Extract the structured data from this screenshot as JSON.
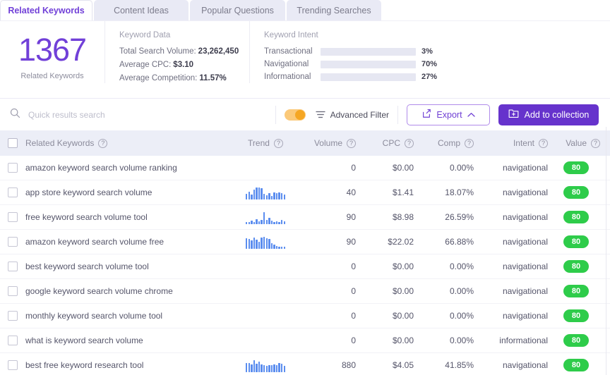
{
  "tabs": [
    {
      "label": "Related Keywords",
      "active": true
    },
    {
      "label": "Content Ideas",
      "active": false
    },
    {
      "label": "Popular Questions",
      "active": false
    },
    {
      "label": "Trending Searches",
      "active": false
    }
  ],
  "summary": {
    "count": "1367",
    "count_label": "Related Keywords",
    "keyword_data": {
      "title": "Keyword Data",
      "rows": [
        {
          "label": "Total Search Volume:",
          "value": "23,262,450"
        },
        {
          "label": "Average CPC:",
          "value": "$3.10"
        },
        {
          "label": "Average Competition:",
          "value": "11.57%"
        }
      ]
    },
    "keyword_intent": {
      "title": "Keyword Intent",
      "rows": [
        {
          "label": "Transactional",
          "pct": "3%",
          "value": 3,
          "color": "#e8312a"
        },
        {
          "label": "Navigational",
          "pct": "70%",
          "value": 70,
          "color": "#fbbc05"
        },
        {
          "label": "Informational",
          "pct": "27%",
          "value": 27,
          "color": "#27c93f"
        }
      ]
    }
  },
  "toolbar": {
    "search_placeholder": "Quick results search",
    "search_value": "",
    "toggle_on": true,
    "advanced_filter_label": "Advanced Filter",
    "export_label": "Export",
    "add_to_collection_label": "Add to collection"
  },
  "table": {
    "columns": [
      {
        "label": "Related Keywords",
        "help": true
      },
      {
        "label": "Trend",
        "help": true
      },
      {
        "label": "Volume",
        "help": true
      },
      {
        "label": "CPC",
        "help": true
      },
      {
        "label": "Comp",
        "help": true
      },
      {
        "label": "Intent",
        "help": true
      },
      {
        "label": "Value",
        "help": true
      }
    ],
    "rows": [
      {
        "keyword": "amazon keyword search volume ranking",
        "trend": [],
        "volume": "0",
        "cpc": "$0.00",
        "comp": "0.00%",
        "intent": "navigational",
        "value": "80"
      },
      {
        "keyword": "app store keyword search volume",
        "trend": [
          8,
          11,
          7,
          14,
          17,
          17,
          16,
          8,
          6,
          9,
          5,
          10,
          9,
          10,
          9,
          7
        ],
        "volume": "40",
        "cpc": "$1.41",
        "comp": "18.07%",
        "intent": "navigational",
        "value": "80"
      },
      {
        "keyword": "free keyword search volume tool",
        "trend": [
          3,
          3,
          5,
          3,
          7,
          4,
          6,
          17,
          6,
          9,
          5,
          3,
          4,
          3,
          6,
          4
        ],
        "volume": "90",
        "cpc": "$8.98",
        "comp": "26.59%",
        "intent": "navigational",
        "value": "80"
      },
      {
        "keyword": "amazon keyword search volume free",
        "trend": [
          15,
          14,
          12,
          16,
          13,
          10,
          16,
          17,
          15,
          14,
          8,
          6,
          4,
          3,
          3,
          3
        ],
        "volume": "90",
        "cpc": "$22.02",
        "comp": "66.88%",
        "intent": "navigational",
        "value": "80"
      },
      {
        "keyword": "best keyword search volume tool",
        "trend": [],
        "volume": "0",
        "cpc": "$0.00",
        "comp": "0.00%",
        "intent": "navigational",
        "value": "80"
      },
      {
        "keyword": "google keyword search volume chrome",
        "trend": [],
        "volume": "0",
        "cpc": "$0.00",
        "comp": "0.00%",
        "intent": "navigational",
        "value": "80"
      },
      {
        "keyword": "monthly keyword search volume tool",
        "trend": [],
        "volume": "0",
        "cpc": "$0.00",
        "comp": "0.00%",
        "intent": "navigational",
        "value": "80"
      },
      {
        "keyword": "what is keyword search volume",
        "trend": [],
        "volume": "0",
        "cpc": "$0.00",
        "comp": "0.00%",
        "intent": "informational",
        "value": "80"
      },
      {
        "keyword": "best free keyword research tool",
        "trend": [
          13,
          13,
          11,
          17,
          12,
          15,
          11,
          10,
          9,
          10,
          10,
          11,
          10,
          13,
          12,
          9
        ],
        "volume": "880",
        "cpc": "$4.05",
        "comp": "41.85%",
        "intent": "navigational",
        "value": "80"
      }
    ]
  },
  "colors": {
    "accent": "#6633cc",
    "accent_light": "#7140d8",
    "badge_green": "#2ecc4a",
    "toggle_orange": "#f5a623",
    "sparkline_blue": "#5b8def"
  }
}
